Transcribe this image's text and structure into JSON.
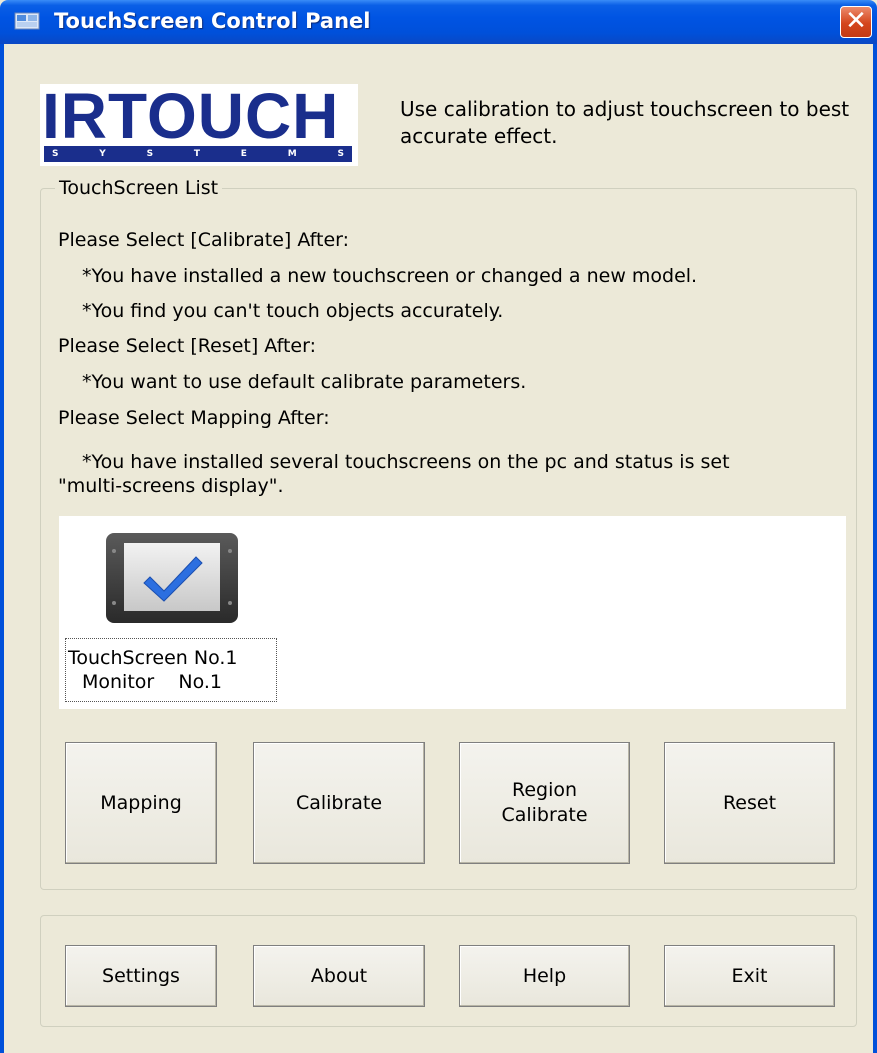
{
  "window": {
    "title": "TouchScreen Control Panel",
    "close_glyph": "✕"
  },
  "logo": {
    "main": "IRTOUCH",
    "sub_letters": [
      "S",
      "Y",
      "S",
      "T",
      "E",
      "M",
      "S"
    ]
  },
  "intro": "Use calibration to adjust touchscreen to best accurate effect.",
  "touchscreen_list": {
    "legend": "TouchScreen List",
    "lines": [
      "Please Select [Calibrate] After:",
      "*You have installed a new touchscreen or changed a new model.",
      "*You find you can't touch objects accurately.",
      "Please Select [Reset] After:",
      "*You want to use default calibrate parameters.",
      "Please Select Mapping After:",
      "*You have installed several touchscreens on the pc and status is set",
      "\"multi-screens display\"."
    ],
    "device": {
      "line1": "TouchScreen No.1",
      "line2": "Monitor    No.1"
    }
  },
  "buttons": {
    "mapping": "Mapping",
    "calibrate": "Calibrate",
    "region_calibrate_1": "Region",
    "region_calibrate_2": "Calibrate",
    "reset": "Reset",
    "settings": "Settings",
    "about": "About",
    "help": "Help",
    "exit": "Exit"
  },
  "icons": {
    "app": "control-panel-icon",
    "device": "monitor-checkmark-icon"
  },
  "colors": {
    "titlebar": "#0054E3",
    "background": "#ECE9D8",
    "logo": "#1A2E8C",
    "checkmark": "#2C6FE0"
  }
}
